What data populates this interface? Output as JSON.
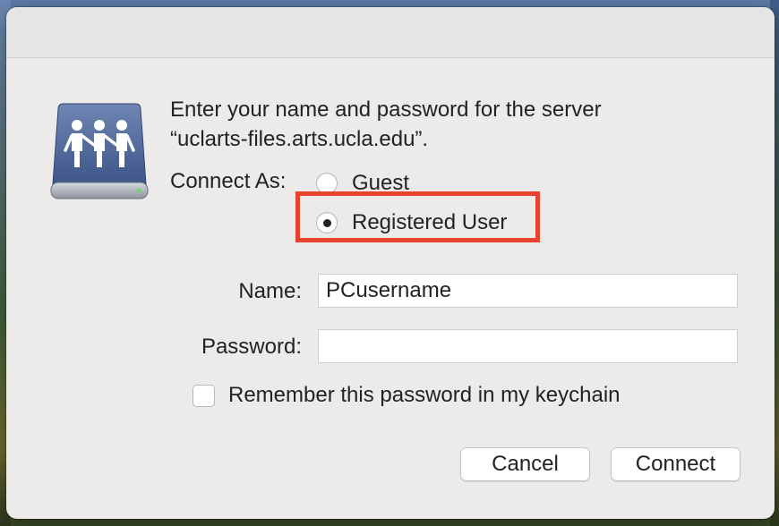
{
  "dialog": {
    "prompt_line1": "Enter your name and password for the server",
    "prompt_line2": "“uclarts-files.arts.ucla.edu”.",
    "connect_as_label": "Connect As:",
    "options": [
      {
        "label": "Guest",
        "selected": false
      },
      {
        "label": "Registered User",
        "selected": true
      }
    ],
    "name_label": "Name:",
    "name_value": "PCusername",
    "password_label": "Password:",
    "password_value": "",
    "remember_label": "Remember this password in my keychain",
    "remember_checked": false,
    "cancel_label": "Cancel",
    "connect_label": "Connect"
  },
  "colors": {
    "highlight": "#e8432e",
    "dialog_bg": "#ecebea"
  },
  "icons": {
    "server": "shared-server-drive-icon"
  }
}
